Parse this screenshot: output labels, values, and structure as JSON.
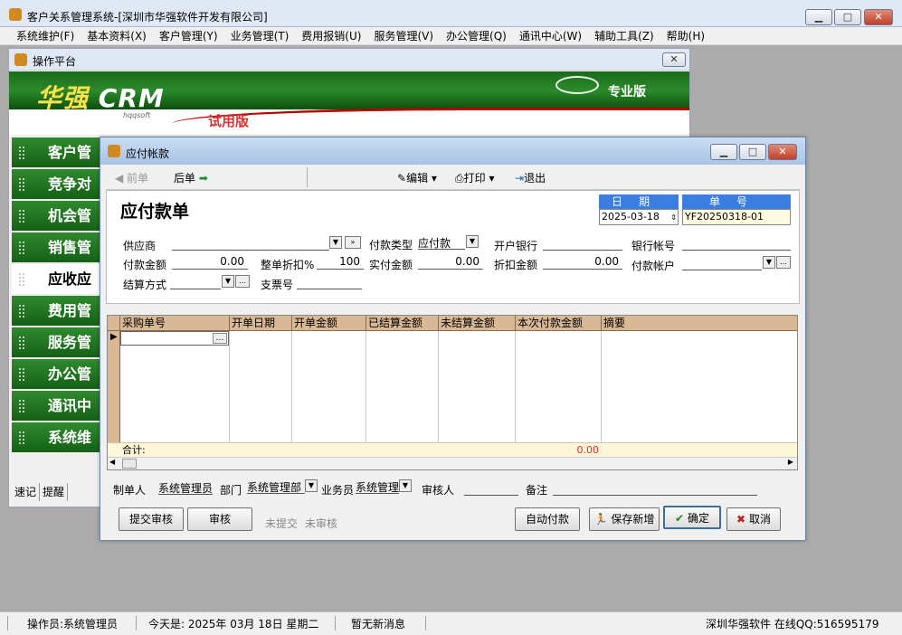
{
  "app": {
    "title": "客户关系管理系统-[深圳市华强软件开发有限公司]"
  },
  "menu": [
    "系统维护(F)",
    "基本资料(X)",
    "客户管理(Y)",
    "业务管理(T)",
    "费用报销(U)",
    "服务管理(V)",
    "办公管理(Q)",
    "通讯中心(W)",
    "辅助工具(Z)",
    "帮助(H)"
  ],
  "platform": {
    "title": "操作平台",
    "logo_main": "华强",
    "logo_crm": "CRM",
    "logo_sub": "hqqsoft",
    "edition": "专业版",
    "trial": "试用版",
    "nav": [
      "客户管理",
      "竞争对手",
      "机会管理",
      "销售管理",
      "应收应付",
      "费用管理",
      "服务管理",
      "办公管理",
      "通讯中心",
      "系统维护"
    ],
    "tabs": [
      "速记",
      "提醒"
    ]
  },
  "payable": {
    "title": "应付帐款",
    "toolbar": {
      "prev": "前单",
      "next": "后单",
      "edit": "编辑",
      "print": "打印",
      "exit": "退出"
    },
    "heading": "应付款单",
    "date_label": "日期",
    "date_value": "2025-03-18",
    "no_label": "单号",
    "no_value": "YF20250318-01",
    "fields": {
      "supplier": "供应商",
      "pay_type_label": "付款类型",
      "pay_type_value": "应付款",
      "bank": "开户银行",
      "account_no": "银行帐号",
      "amount_label": "付款金额",
      "amount_value": "0.00",
      "discount_rate_label": "整单折扣%",
      "discount_rate_value": "100",
      "actual_label": "实付金额",
      "actual_value": "0.00",
      "discount_amt_label": "折扣金额",
      "discount_amt_value": "0.00",
      "pay_account": "付款帐户",
      "settle": "结算方式",
      "check_no": "支票号"
    },
    "grid": {
      "headers": [
        "采购单号",
        "开单日期",
        "开单金额",
        "已结算金额",
        "未结算金额",
        "本次付款金额",
        "摘要"
      ],
      "total_label": "合计:",
      "total_value": "0.00"
    },
    "footer": {
      "maker_label": "制单人",
      "maker_value": "系统管理员",
      "dept_label": "部门",
      "dept_value": "系统管理部",
      "clerk_label": "业务员",
      "clerk_value": "系统管理",
      "auditor_label": "审核人",
      "note_label": "备注"
    },
    "buttons": {
      "submit": "提交审核",
      "audit": "审核",
      "state1": "未提交",
      "state2": "未审核",
      "auto": "自动付款",
      "save_new": "保存新增",
      "ok": "确定",
      "cancel": "取消"
    }
  },
  "status": {
    "operator": "操作员:系统管理员",
    "today": "今天是: 2025年 03月 18日  星期二",
    "msg": "暂无新消息",
    "company": "深圳华强软件 在线QQ:516595179"
  }
}
